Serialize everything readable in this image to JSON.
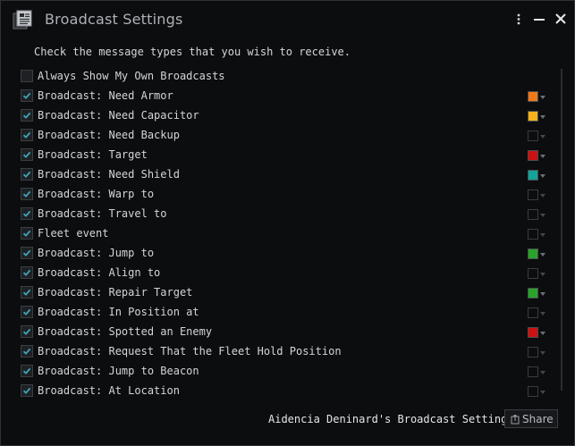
{
  "window": {
    "title": "Broadcast Settings",
    "icons": {
      "app": "document-icon",
      "menu": "kebab-menu-icon",
      "minimize": "minimize-icon",
      "close": "close-icon"
    }
  },
  "instructions": "Check the message types that you wish to receive.",
  "items": [
    {
      "label": "Always Show My Own Broadcasts",
      "checked": false,
      "color": null
    },
    {
      "label": "Broadcast: Need Armor",
      "checked": true,
      "color": "#f07a1a"
    },
    {
      "label": "Broadcast: Need Capacitor",
      "checked": true,
      "color": "#f5b21a"
    },
    {
      "label": "Broadcast: Need Backup",
      "checked": true,
      "color": ""
    },
    {
      "label": "Broadcast: Target",
      "checked": true,
      "color": "#cc1111"
    },
    {
      "label": "Broadcast: Need Shield",
      "checked": true,
      "color": "#13a39a"
    },
    {
      "label": "Broadcast: Warp to",
      "checked": true,
      "color": ""
    },
    {
      "label": "Broadcast: Travel to",
      "checked": true,
      "color": ""
    },
    {
      "label": "Fleet event",
      "checked": true,
      "color": ""
    },
    {
      "label": "Broadcast: Jump to",
      "checked": true,
      "color": "#2aa32a"
    },
    {
      "label": "Broadcast: Align to",
      "checked": true,
      "color": ""
    },
    {
      "label": "Broadcast: Repair Target",
      "checked": true,
      "color": "#2aa32a"
    },
    {
      "label": "Broadcast: In Position at",
      "checked": true,
      "color": ""
    },
    {
      "label": "Broadcast: Spotted an Enemy",
      "checked": true,
      "color": "#cc1111"
    },
    {
      "label": "Broadcast: Request That the Fleet Hold Position",
      "checked": true,
      "color": ""
    },
    {
      "label": "Broadcast: Jump to Beacon",
      "checked": true,
      "color": ""
    },
    {
      "label": "Broadcast: At Location",
      "checked": true,
      "color": ""
    }
  ],
  "footer": {
    "settings_label": "Aidencia Deninard's Broadcast Settings",
    "share_label": "Share",
    "share_icon": "share-icon"
  },
  "colors": {
    "check": "#3fa4b8",
    "text": "#d2d5d8",
    "background": "#0c0d0f"
  }
}
